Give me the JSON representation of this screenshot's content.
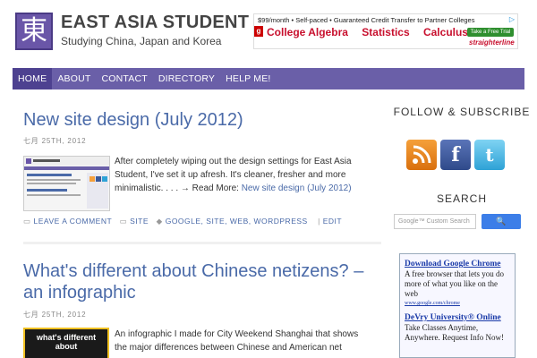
{
  "site": {
    "logo_char": "東",
    "title": "EAST ASIA STUDENT",
    "tagline": "Studying China, Japan and Korea"
  },
  "banner_ad": {
    "top_line": "$99/month • Self-paced • Guaranteed Credit Transfer to Partner Colleges",
    "close": "▷",
    "links": [
      "College Algebra",
      "Statistics",
      "Calculus"
    ],
    "trial_label": "Take a Free Trial",
    "brand": "straighterline"
  },
  "nav": {
    "items": [
      "HOME",
      "ABOUT",
      "CONTACT",
      "DIRECTORY",
      "HELP ME!"
    ],
    "active": "HOME"
  },
  "posts": [
    {
      "title": "New site design (July 2012)",
      "date": "七月 25TH, 2012",
      "excerpt": "After completely wiping out the design settings for East Asia Student, I've set it up afresh. It's cleaner, fresher and more minimalistic. . . . → Read More: ",
      "read_more_link": "New site design (July 2012)",
      "meta": {
        "comment": "LEAVE A COMMENT",
        "category": "SITE",
        "tags": "GOOGLE, SITE, WEB, WORDPRESS",
        "edit": "EDIT"
      }
    },
    {
      "title": "What's different about Chinese netizens? – an infographic",
      "date": "七月 25TH, 2012",
      "thumb_text": "what's different about",
      "excerpt": "An infographic I made for City Weekend Shanghai that shows the major differences between Chinese and American net users."
    }
  ],
  "sidebar": {
    "follow_heading": "FOLLOW & SUBSCRIBE",
    "social": [
      "rss-icon",
      "facebook-icon",
      "twitter-icon"
    ],
    "search_heading": "SEARCH",
    "search_placeholder": "Google™ Custom Search",
    "search_button": "🔍",
    "ads": [
      {
        "headline": "Download Google Chrome",
        "text": "A free browser that lets you do more of what you like on the web",
        "url": "www.google.com/chrome"
      },
      {
        "headline": "DeVry University® Online",
        "text": "Take Classes Anytime, Anywhere. Request Info Now!"
      }
    ]
  },
  "colors": {
    "nav_bg": "#6a5fa8",
    "nav_active": "#4d4190",
    "link": "#4a6aa8",
    "logo_bg": "#6a56a8"
  }
}
